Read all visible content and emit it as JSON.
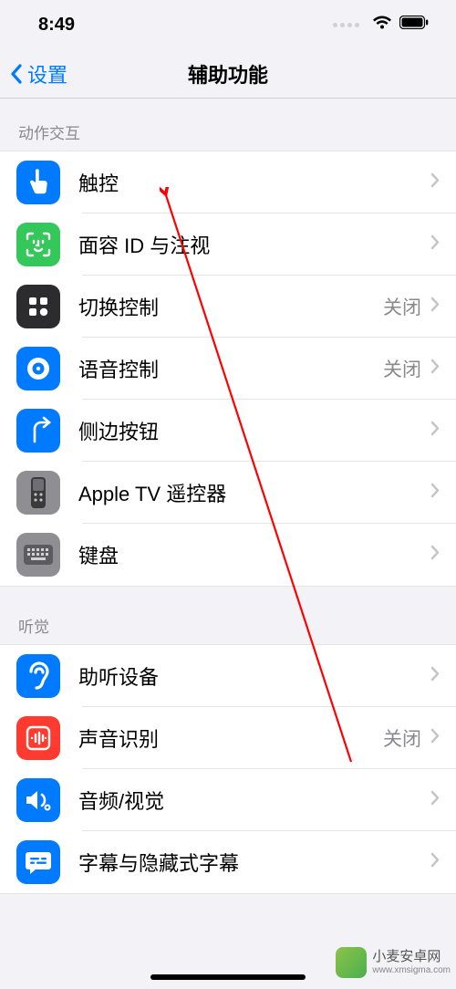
{
  "status": {
    "time": "8:49"
  },
  "nav": {
    "back": "设置",
    "title": "辅助功能"
  },
  "sections": {
    "motor": {
      "header": "动作交互",
      "rows": {
        "touch": {
          "label": "触控"
        },
        "faceid": {
          "label": "面容 ID 与注视"
        },
        "switch": {
          "label": "切换控制",
          "value": "关闭"
        },
        "voice": {
          "label": "语音控制",
          "value": "关闭"
        },
        "sidebutton": {
          "label": "侧边按钮"
        },
        "atv": {
          "label": "Apple TV 遥控器"
        },
        "keyboard": {
          "label": "键盘"
        }
      }
    },
    "hearing": {
      "header": "听觉",
      "rows": {
        "hearingdev": {
          "label": "助听设备"
        },
        "soundrec": {
          "label": "声音识别",
          "value": "关闭"
        },
        "audiovisual": {
          "label": "音频/视觉"
        },
        "subtitles": {
          "label": "字幕与隐藏式字幕"
        }
      }
    }
  },
  "colors": {
    "blue": "#007aff",
    "green": "#34c759",
    "gray": "#8e8e93",
    "darkgray": "#5b5b60",
    "red": "#ff3b30"
  },
  "watermark": {
    "name": "小麦安卓网",
    "url": "www.xmsigma.com"
  }
}
